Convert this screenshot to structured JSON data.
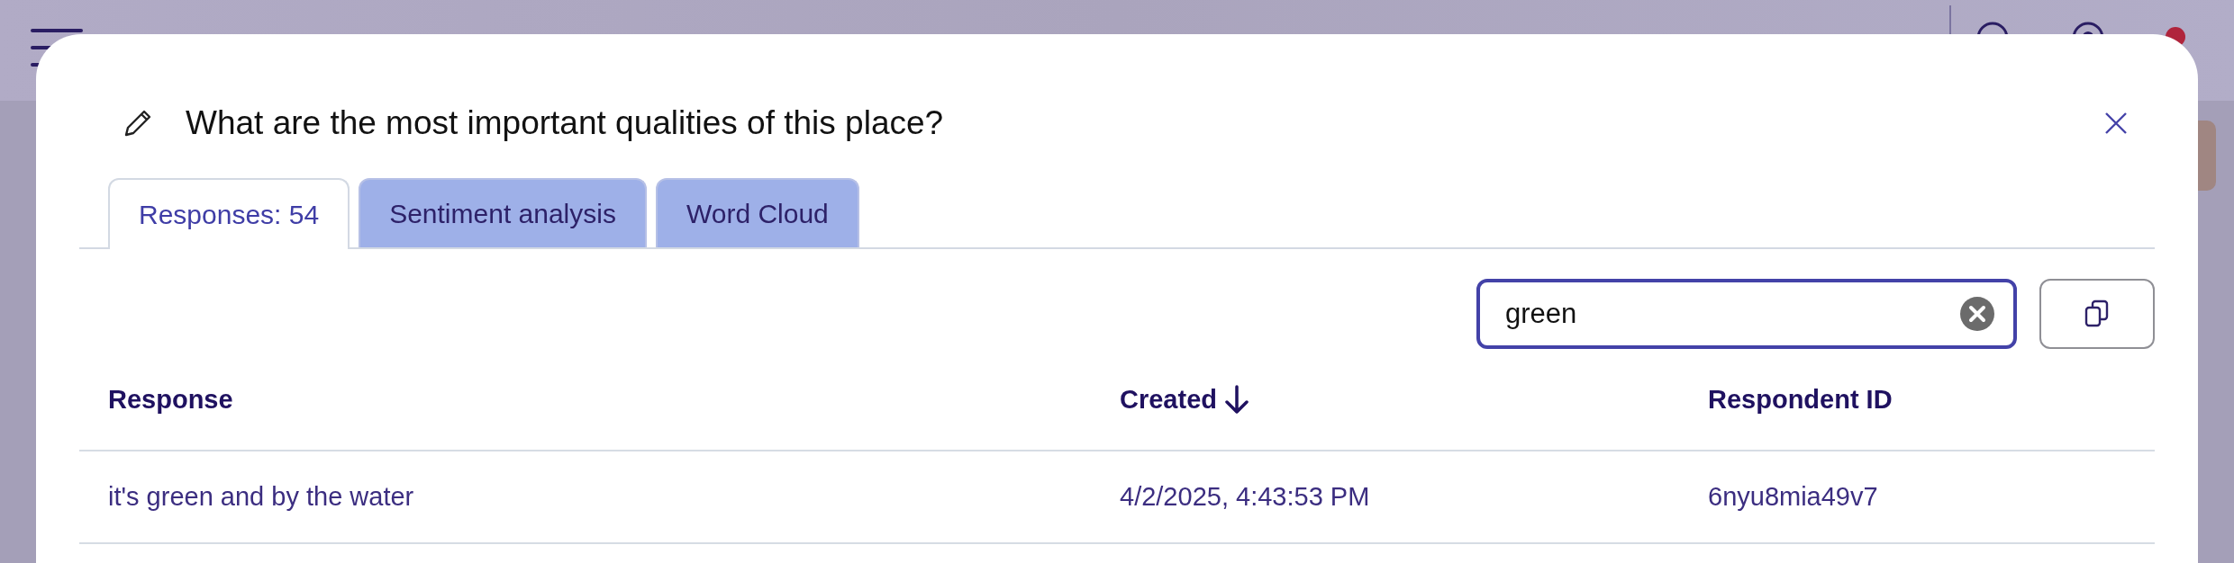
{
  "app_bar": {
    "notification_dot": {
      "color": "#b0243c"
    }
  },
  "modal": {
    "title": "What are the most important qualities of this place?",
    "tabs": [
      {
        "label": "Responses: 54",
        "selected": true
      },
      {
        "label": "Sentiment analysis",
        "selected": false
      },
      {
        "label": "Word Cloud",
        "selected": false
      }
    ],
    "search": {
      "value": "green"
    },
    "table": {
      "columns": [
        {
          "label": "Response",
          "sorted": false
        },
        {
          "label": "Created",
          "sorted": true
        },
        {
          "label": "Respondent ID",
          "sorted": false
        }
      ],
      "rows": [
        [
          "it's green and by the water",
          "4/2/2025, 4:43:53 PM",
          "6nyu8mia49v7"
        ]
      ]
    }
  }
}
